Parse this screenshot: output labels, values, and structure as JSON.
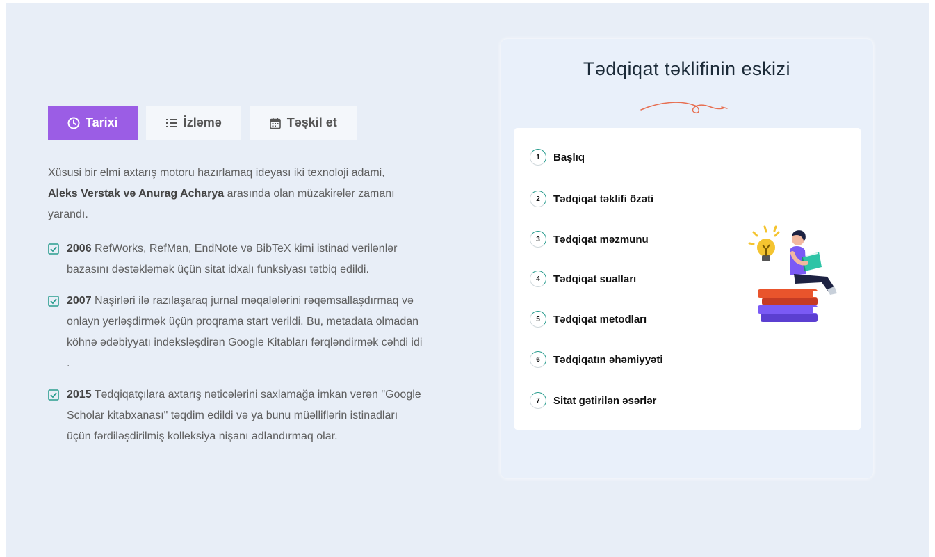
{
  "tabs": [
    {
      "label": "Tarixi",
      "icon": "clock-icon",
      "active": true
    },
    {
      "label": "İzləmə",
      "icon": "list-icon",
      "active": false
    },
    {
      "label": "Təşkil et",
      "icon": "calendar-icon",
      "active": false
    }
  ],
  "intro": {
    "before": "Xüsusi bir elmi axtarış motoru hazırlamaq ideyası iki texnoloji adami, ",
    "bold": "Aleks Verstak və Anurag Acharya",
    "after": " arasında olan müzakirələr zamanı yarandı."
  },
  "timeline": [
    {
      "year": "2006",
      "text": " RefWorks, RefMan, EndNote və BibTeX kimi istinad verilənlər bazasını dəstəkləmək üçün sitat idxalı funksiyası tətbiq edildi."
    },
    {
      "year": "2007",
      "text": " Naşirləri ilə razılaşaraq jurnal məqalələrini rəqəmsallaşdırmaq və onlayn yerləşdirmək üçün proqrama start verildi. Bu, metadata olmadan köhnə ədəbiyyatı indeksləşdirən Google Kitabları fərqləndirmək cəhdi idi ."
    },
    {
      "year": "2015",
      "text": " Tədqiqatçılara axtarış nəticələrini saxlamağa imkan verən \"Google Scholar kitabxanası\" təqdim edildi və ya bunu müəlliflərin istinadları üçün fərdiləşdirilmiş kolleksiya nişanı adlandırmaq olar."
    }
  ],
  "outline": {
    "title": "Tədqiqat təklifinin eskizi",
    "steps": [
      {
        "num": "1",
        "label": "Başlıq"
      },
      {
        "num": "2",
        "label": "Tədqiqat təklifi özəti"
      },
      {
        "num": "3",
        "label": "Tədqiqat məzmunu"
      },
      {
        "num": "4",
        "label": "Tədqiqat sualları"
      },
      {
        "num": "5",
        "label": "Tədqiqat metodları"
      },
      {
        "num": "6",
        "label": "Tədqiqatın əhəmiyyəti"
      },
      {
        "num": "7",
        "label": "Sitat gətirilən əsərlər"
      }
    ]
  },
  "colors": {
    "accent": "#9b5de5",
    "background": "#e8eef7",
    "check": "#2a9d8f",
    "swash": "#e76f51"
  }
}
